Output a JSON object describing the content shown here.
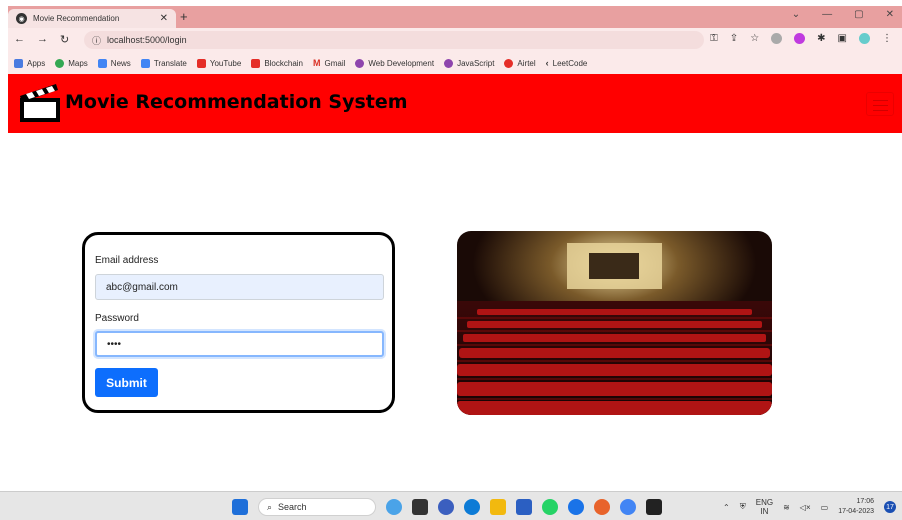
{
  "browser": {
    "tab_title": "Movie Recommendation",
    "url": "localhost:5000/login",
    "bookmarks": [
      "Apps",
      "Maps",
      "News",
      "Translate",
      "YouTube",
      "Blockchain",
      "Gmail",
      "Web Development",
      "JavaScript",
      "Airtel",
      "LeetCode"
    ]
  },
  "app": {
    "brand": "Movie Recommendation System",
    "accent_color": "#ff0000"
  },
  "login": {
    "email_label": "Email address",
    "email_value": "abc@gmail.com",
    "password_label": "Password",
    "password_value": "••••",
    "submit_label": "Submit"
  },
  "taskbar": {
    "search_placeholder": "Search",
    "language": "ENG",
    "region": "IN",
    "time": "17:06",
    "date": "17-04-2023",
    "notification_count": "17"
  }
}
